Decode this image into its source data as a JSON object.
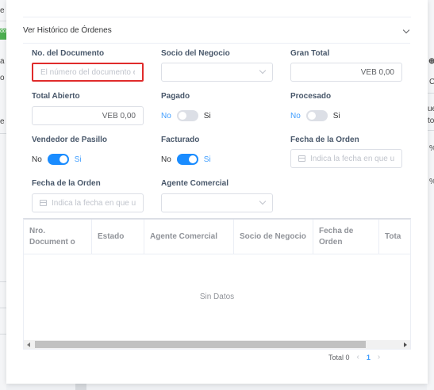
{
  "background": {
    "frag_e1": "e",
    "frag_tag": "do",
    "frag_a": "a",
    "frag_o": "o",
    "frag_e2": "e",
    "right_frags": [
      "C",
      "ue",
      "to",
      "%",
      "%"
    ]
  },
  "collapse": {
    "title": "Ver Histórico de Órdenes"
  },
  "filters": {
    "doc_no": {
      "label": "No. del Documento",
      "placeholder": "El número del documento es"
    },
    "socio": {
      "label": "Socio del Negocio",
      "value": ""
    },
    "gran_total": {
      "label": "Gran Total",
      "value": "VEB 0,00"
    },
    "total_abierto": {
      "label": "Total Abierto",
      "value": "VEB 0,00"
    },
    "pagado": {
      "label": "Pagado",
      "no": "No",
      "si": "Si",
      "on": false
    },
    "procesado": {
      "label": "Procesado",
      "no": "No",
      "si": "Si",
      "on": false
    },
    "vendedor": {
      "label": "Vendedor de Pasillo",
      "no": "No",
      "si": "Si",
      "on": true
    },
    "facturado": {
      "label": "Facturado",
      "no": "No",
      "si": "Si",
      "on": true
    },
    "fecha_orden_1": {
      "label": "Fecha de la Orden",
      "placeholder": "Indica la fecha en que u"
    },
    "fecha_orden_2": {
      "label": "Fecha de la Orden",
      "placeholder": "Indica la fecha en que u"
    },
    "agente": {
      "label": "Agente Comercial",
      "value": ""
    }
  },
  "table": {
    "columns": [
      "Nro. Document o",
      "Estado",
      "Agente Comercial",
      "Socio de Negocio",
      "Fecha de Orden",
      "Tota"
    ],
    "empty_text": "Sin Datos"
  },
  "pager": {
    "total": "Total 0",
    "prev": "‹",
    "current": "1",
    "next": "›"
  },
  "colors": {
    "accent": "#409eff",
    "switch_on": "#1a8cff",
    "error_border": "#e02b2b"
  }
}
